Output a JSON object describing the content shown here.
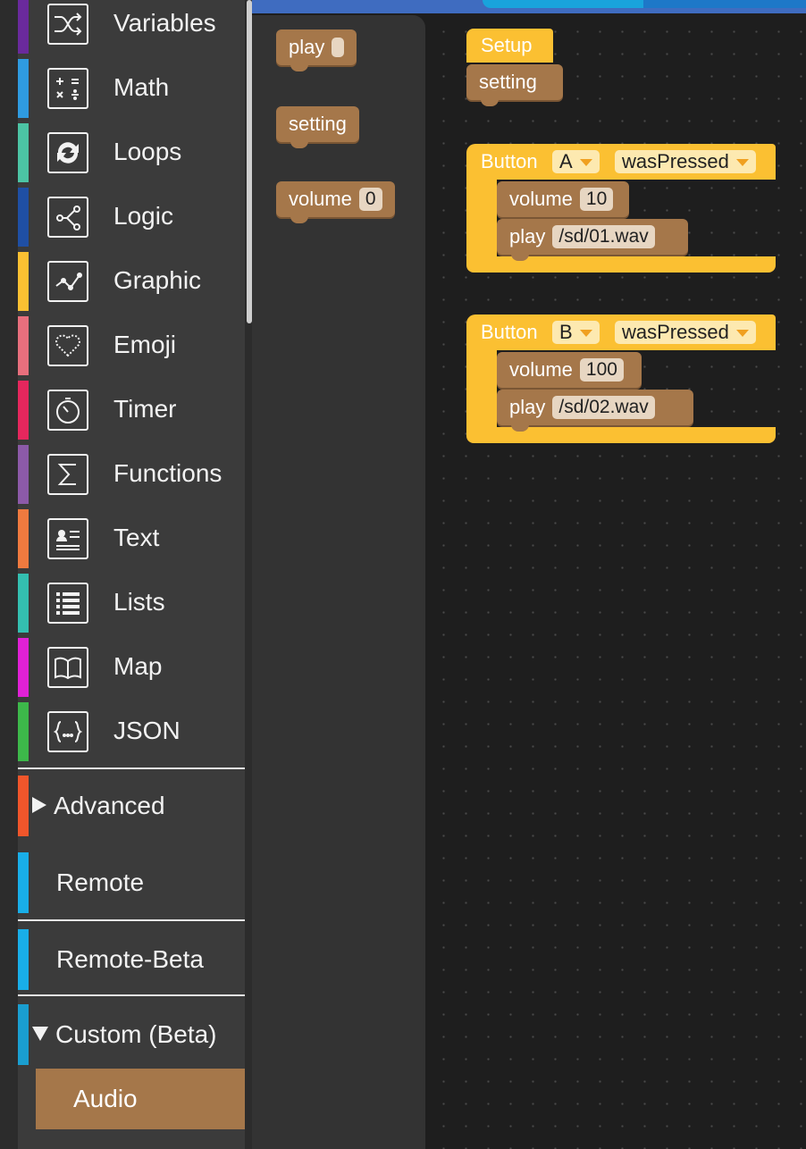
{
  "categories": [
    {
      "label": "Variables",
      "color": "#6a2a9c",
      "icon": "shuffle-icon"
    },
    {
      "label": "Math",
      "color": "#2f9be0",
      "icon": "calculator-icon"
    },
    {
      "label": "Loops",
      "color": "#4cc4a4",
      "icon": "loop-arrows-icon"
    },
    {
      "label": "Logic",
      "color": "#1f4fa4",
      "icon": "branch-icon"
    },
    {
      "label": "Graphic",
      "color": "#fbc032",
      "icon": "graph-line-icon"
    },
    {
      "label": "Emoji",
      "color": "#e76f7d",
      "icon": "heart-icon"
    },
    {
      "label": "Timer",
      "color": "#e5275d",
      "icon": "clock-icon"
    },
    {
      "label": "Functions",
      "color": "#8c5aa8",
      "icon": "sigma-icon"
    },
    {
      "label": "Text",
      "color": "#ef7a3f",
      "icon": "text-card-icon"
    },
    {
      "label": "Lists",
      "color": "#34bfb0",
      "icon": "list-icon"
    },
    {
      "label": "Map",
      "color": "#e021d6",
      "icon": "book-map-icon"
    },
    {
      "label": "JSON",
      "color": "#3db84a",
      "icon": "json-braces-icon"
    }
  ],
  "groups": {
    "advanced": {
      "label": "Advanced",
      "color": "#f0562b"
    },
    "remote": {
      "label": "Remote",
      "color": "#19aee8"
    },
    "remote_beta": {
      "label": "Remote-Beta",
      "color": "#19aee8"
    },
    "custom": {
      "label": "Custom (Beta)",
      "color": "#1a9ed0"
    },
    "audio": {
      "label": "Audio",
      "color": "#a5774a"
    }
  },
  "flyout": {
    "play": {
      "label": "play"
    },
    "setting": {
      "label": "setting"
    },
    "volume": {
      "label": "volume",
      "value": "0"
    }
  },
  "workspace": {
    "setup": {
      "hat_label": "Setup",
      "block_label": "setting"
    },
    "events": [
      {
        "label": "Button",
        "button": "A",
        "event": "wasPressed",
        "volume_label": "volume",
        "volume_value": "10",
        "play_label": "play",
        "play_file": "/sd/01.wav"
      },
      {
        "label": "Button",
        "button": "B",
        "event": "wasPressed",
        "volume_label": "volume",
        "volume_value": "100",
        "play_label": "play",
        "play_file": "/sd/02.wav"
      }
    ]
  },
  "colors": {
    "custom_block": "#a5774a",
    "event_block": "#fbc032",
    "workspace_bg": "#1e1e1e",
    "sidebar_bg": "#3b3b3b"
  }
}
